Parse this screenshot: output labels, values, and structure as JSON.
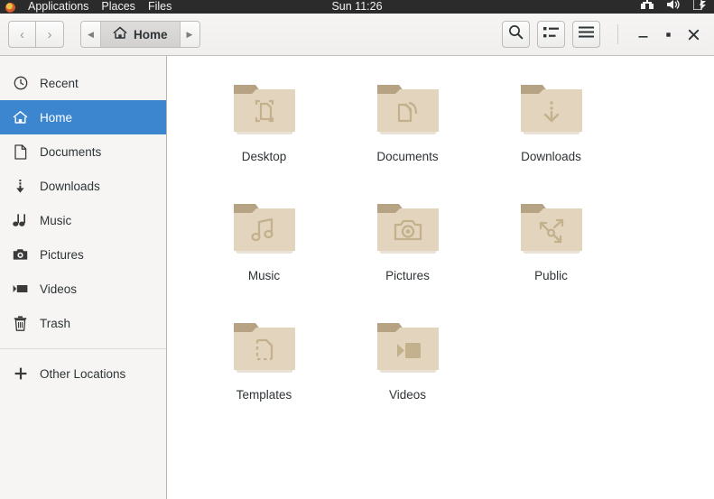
{
  "topbar": {
    "logo_icon": "fedora-logo-icon",
    "menus": [
      "Applications",
      "Places",
      "Files"
    ],
    "clock": "Sun 11:26",
    "indicators": [
      "network-icon",
      "volume-icon",
      "power-icon"
    ]
  },
  "headerbar": {
    "back_label": "‹",
    "forward_label": "›",
    "path_prev_label": "◀",
    "path_next_label": "▶",
    "breadcrumb": {
      "icon": "home-icon",
      "label": "Home"
    },
    "search_icon": "search-icon",
    "list_view_icon": "list-view-icon",
    "menu_icon": "hamburger-menu-icon",
    "minimize_label": "–",
    "maximize_label": "▫",
    "close_label": "✕"
  },
  "sidebar": {
    "items": [
      {
        "label": "Recent",
        "icon": "clock-icon",
        "selected": false
      },
      {
        "label": "Home",
        "icon": "home-icon",
        "selected": true
      },
      {
        "label": "Documents",
        "icon": "document-icon",
        "selected": false
      },
      {
        "label": "Downloads",
        "icon": "download-icon",
        "selected": false
      },
      {
        "label": "Music",
        "icon": "music-note-icon",
        "selected": false
      },
      {
        "label": "Pictures",
        "icon": "camera-icon",
        "selected": false
      },
      {
        "label": "Videos",
        "icon": "video-icon",
        "selected": false
      },
      {
        "label": "Trash",
        "icon": "trash-icon",
        "selected": false
      }
    ],
    "other_locations": {
      "label": "Other Locations",
      "icon": "plus-icon"
    }
  },
  "files": [
    {
      "name": "Desktop",
      "icon": "folder-desktop-icon",
      "glyph": "desktop"
    },
    {
      "name": "Documents",
      "icon": "folder-documents-icon",
      "glyph": "documents"
    },
    {
      "name": "Downloads",
      "icon": "folder-downloads-icon",
      "glyph": "downloads"
    },
    {
      "name": "Music",
      "icon": "folder-music-icon",
      "glyph": "music"
    },
    {
      "name": "Pictures",
      "icon": "folder-pictures-icon",
      "glyph": "pictures"
    },
    {
      "name": "Public",
      "icon": "folder-public-icon",
      "glyph": "public"
    },
    {
      "name": "Templates",
      "icon": "folder-templates-icon",
      "glyph": "templates"
    },
    {
      "name": "Videos",
      "icon": "folder-videos-icon",
      "glyph": "videos"
    }
  ],
  "colors": {
    "accent": "#3c86d0",
    "folder_body": "#e3d5bd",
    "folder_tab": "#b5a383",
    "folder_glyph": "#c3b08d",
    "header_bg": "#f2f1f0",
    "sidebar_bg": "#f6f5f4",
    "topbar_bg": "#2b2b2b"
  }
}
